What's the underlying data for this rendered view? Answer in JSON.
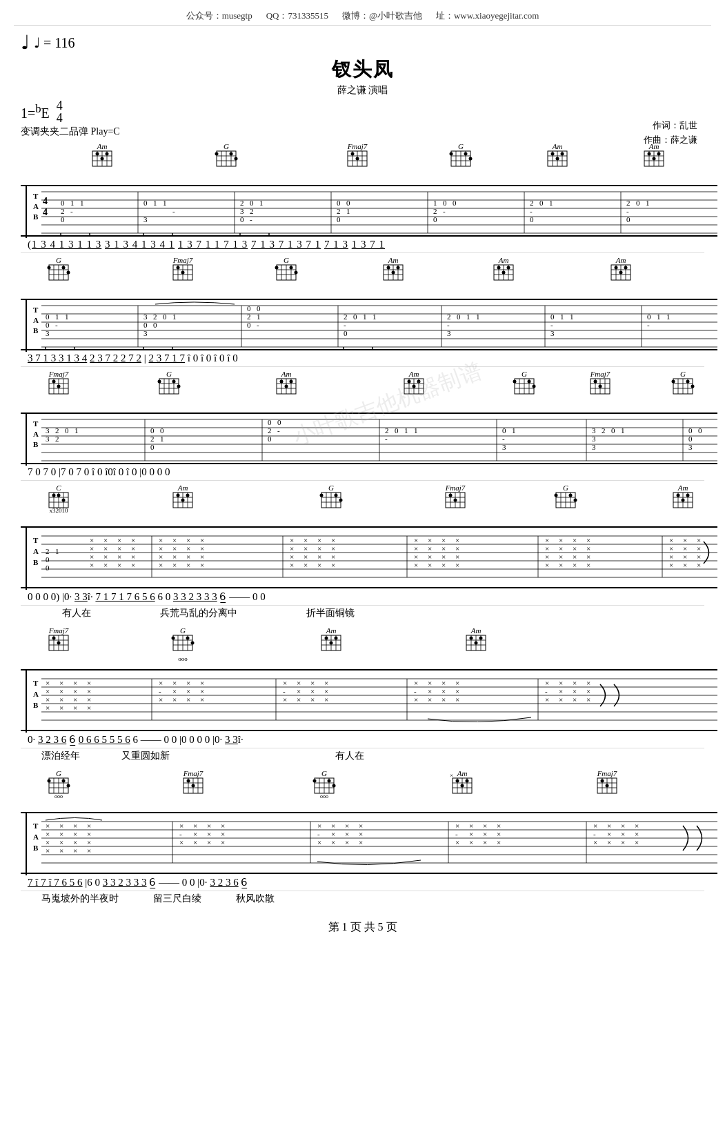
{
  "header": {
    "wechat": "公众号：musegtp",
    "qq": "QQ：731335515",
    "weibo": "微博：@小叶歌吉他",
    "website": "址：www.xiaoyegejitar.com"
  },
  "song": {
    "title": "钗头凤",
    "performer": "薛之谦 演唱",
    "lyricist": "作词：乱世",
    "composer": "作曲：薛之谦"
  },
  "music": {
    "tempo": "♩ = 116",
    "key": "1=ᵇE",
    "time_signature": "4/4",
    "capo": "变调夹夹二品弹 Play=C"
  },
  "footer": {
    "page_info": "第 1 页  共 5 页"
  },
  "notation_rows": [
    "(1̲3̲4̲1̲3̲1̲1̲3  3̲1̲3̲4̲1̲3̲4̲1  1̲3̲7̲1̲1̲7̲1̲3  7̲1̲3̲7̲1̲3̲7̲1  7̲1̲3  1̲3̲7̲1̲",
    "3̲7̲1̲3̲3̲1̲3̲4  2̲3̲7̲2̲2̲7̲2  |2̲3  7̲1̲7  î  0  î  0  î  0  î  0",
    "7  0  7  0  |7  0  7  0  î  0  î0î  0  î  0  |0  0  0  0",
    "0  0  0  0)  |0·  3̲3̲î·  7̲1̲7̲1̲7̲6̲5̲6  6  0  3̲3̲2̲3̲3̲3  6̲  ——  0  0",
    "0·  3̲2̲3̲6̲  6̲  0̲6̲6̲5̲5̲5̲6  6  ——  0  0  |0  0  0  0  |0·  3̲3̲î·",
    "7̲î7̲î7̲6̲5̲6  |6  0  3̲3̲2̲3̲3̲3  6̲  ——  0  0  |0·  3̲2̲3̲6̲  6̲"
  ],
  "lyrics_rows": [
    {
      "parts": [
        "有人在",
        "兵荒马乱的分离中",
        "折半面铜镜"
      ]
    },
    {
      "parts": [
        "漂泊经年",
        "又重圆如新",
        "",
        "",
        "",
        "有人在"
      ]
    },
    {
      "parts": [
        "马嵬坡外的半夜时",
        "留三尺白绫",
        "秋风吹散"
      ]
    }
  ]
}
